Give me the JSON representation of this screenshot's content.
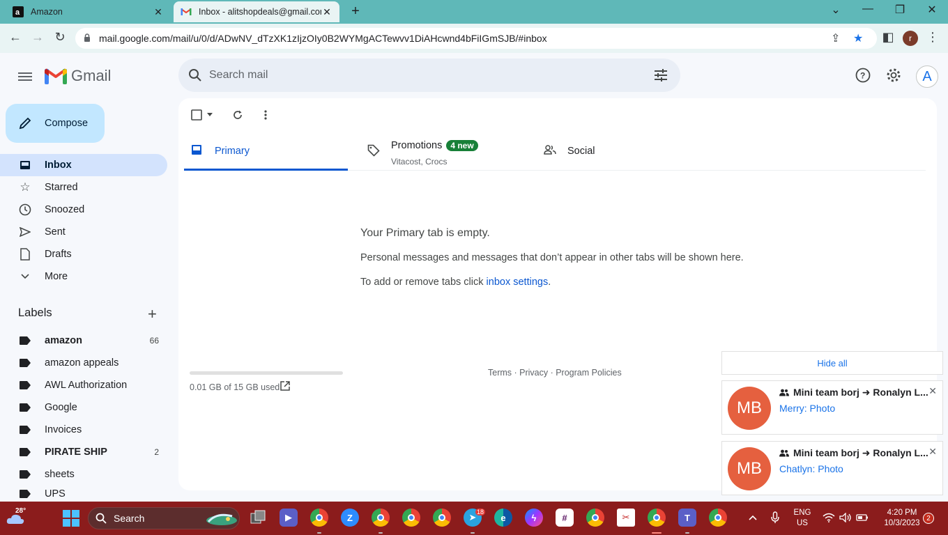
{
  "browser": {
    "tabs": [
      {
        "title": "Amazon",
        "favicon": "amazon-icon"
      },
      {
        "title": "Inbox - alitshopdeals@gmail.com",
        "favicon": "gmail-icon"
      }
    ],
    "url": "mail.google.com/mail/u/0/d/ADwNV_dTzXK1zIjzOIy0B2WYMgACTewvv1DiAHcwnd4bFiIGmSJB/#inbox",
    "profile_initial": "r"
  },
  "gmail": {
    "brand": "Gmail",
    "search_placeholder": "Search mail",
    "account_initial": "A",
    "compose_label": "Compose",
    "nav": [
      {
        "label": "Inbox",
        "icon": "inbox-icon",
        "active": true
      },
      {
        "label": "Starred",
        "icon": "star-icon"
      },
      {
        "label": "Snoozed",
        "icon": "clock-icon"
      },
      {
        "label": "Sent",
        "icon": "send-icon"
      },
      {
        "label": "Drafts",
        "icon": "draft-icon"
      },
      {
        "label": "More",
        "icon": "chevron-down-icon"
      }
    ],
    "labels_header": "Labels",
    "labels": [
      {
        "name": "amazon",
        "count": "66",
        "bold": true
      },
      {
        "name": "amazon appeals",
        "count": ""
      },
      {
        "name": "AWL Authorization",
        "count": ""
      },
      {
        "name": "Google",
        "count": ""
      },
      {
        "name": "Invoices",
        "count": ""
      },
      {
        "name": "PIRATE SHIP",
        "count": "2",
        "bold": true
      },
      {
        "name": "sheets",
        "count": ""
      },
      {
        "name": "UPS",
        "count": ""
      }
    ],
    "tabs": {
      "primary": "Primary",
      "promotions": "Promotions",
      "promotions_badge": "4 new",
      "promotions_sub": "Vitacost, Crocs",
      "social": "Social"
    },
    "empty": {
      "title": "Your Primary tab is empty.",
      "line1": "Personal messages and messages that don’t appear in other tabs will be shown here.",
      "line2_prefix": "To add or remove tabs click ",
      "line2_link": "inbox settings",
      "line2_suffix": "."
    },
    "storage": {
      "text": "0.01 GB of 15 GB used",
      "fraction": 0.0007
    },
    "footer": "Terms · Privacy · Program Policies"
  },
  "notifications": {
    "hide_all": "Hide all",
    "items": [
      {
        "initials": "MB",
        "title": "Mini team borj ➜ Ronalyn L...",
        "body": "Merry: Photo"
      },
      {
        "initials": "MB",
        "title": "Mini team borj ➜ Ronalyn L...",
        "body": "Chatlyn: Photo"
      }
    ]
  },
  "taskbar": {
    "weather_temp": "28°",
    "search_label": "Search",
    "lang_top": "ENG",
    "lang_bottom": "US",
    "time": "4:20 PM",
    "date": "10/3/2023",
    "notification_count": "2",
    "telegram_badge": "18"
  },
  "colors": {
    "taskbar": "#8b1c1c",
    "tabbar": "#5fb8b8",
    "compose": "#c2e7ff",
    "accent": "#0b57d0",
    "avatar": "#e5603f"
  }
}
